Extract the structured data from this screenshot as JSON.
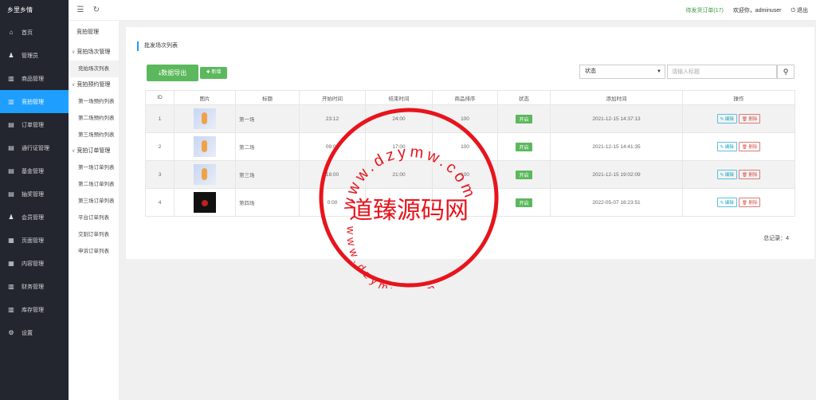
{
  "app": {
    "brand": "乡里乡情"
  },
  "sidebar": {
    "items": [
      {
        "label": "首页",
        "icon": "home-icon",
        "glyph": "⌂"
      },
      {
        "label": "管理员",
        "icon": "user-icon",
        "glyph": "♟"
      },
      {
        "label": "商品管理",
        "icon": "gift-icon",
        "glyph": "▥"
      },
      {
        "label": "竞拍管理",
        "icon": "gift-icon",
        "glyph": "▥",
        "active": true
      },
      {
        "label": "订单管理",
        "icon": "list-icon",
        "glyph": "▤"
      },
      {
        "label": "通行证管理",
        "icon": "list-icon",
        "glyph": "▤"
      },
      {
        "label": "基金管理",
        "icon": "list-icon",
        "glyph": "▤"
      },
      {
        "label": "抽奖管理",
        "icon": "list-icon",
        "glyph": "▤"
      },
      {
        "label": "会员管理",
        "icon": "member-icon",
        "glyph": "♟"
      },
      {
        "label": "页面管理",
        "icon": "page-icon",
        "glyph": "▦"
      },
      {
        "label": "内容管理",
        "icon": "page-icon",
        "glyph": "▦"
      },
      {
        "label": "财务管理",
        "icon": "chart-icon",
        "glyph": "▥"
      },
      {
        "label": "库存管理",
        "icon": "chart-icon",
        "glyph": "▥"
      },
      {
        "label": "设置",
        "icon": "gear-icon",
        "glyph": "⚙"
      }
    ]
  },
  "topbar": {
    "pending_orders": "待发货订单(17)",
    "welcome": "欢迎你，adminuser",
    "logout": "退出"
  },
  "subnav": {
    "title": "竞拍管理",
    "groups": [
      {
        "label": "竞拍场次管理",
        "links": [
          "竞拍场次列表"
        ]
      },
      {
        "label": "竞拍预约管理",
        "links": [
          "第一场预约列表",
          "第二场预约列表",
          "第三场预约列表"
        ]
      },
      {
        "label": "竞拍订单管理",
        "links": [
          "第一场订单列表",
          "第二场订单列表",
          "第三场订单列表",
          "平台订单列表",
          "交割订单列表",
          "申诉订单列表"
        ]
      }
    ]
  },
  "panel": {
    "title": "批发场次列表",
    "export_label": "数据导出",
    "new_label": "新增",
    "status_select": "状态",
    "search_placeholder": "请输入标题",
    "total": "总记录：4"
  },
  "table": {
    "headers": [
      "ID",
      "图片",
      "标题",
      "开始时间",
      "结束时间",
      "商品排序",
      "状态",
      "添加时间",
      "操作"
    ],
    "rows": [
      {
        "id": "1",
        "title": "第一场",
        "start": "23:12",
        "end": "24:00",
        "sort": "100",
        "status": "开启",
        "added": "2021-12-15 14:37:13",
        "img": "light"
      },
      {
        "id": "2",
        "title": "第二场",
        "start": "09:00",
        "end": "17:00",
        "sort": "100",
        "status": "开启",
        "added": "2021-12-15 14:41:35",
        "img": "light"
      },
      {
        "id": "3",
        "title": "第三场",
        "start": "18:00",
        "end": "21:00",
        "sort": "100",
        "status": "开启",
        "added": "2021-12-15 19:02:09",
        "img": "light"
      },
      {
        "id": "4",
        "title": "第四场",
        "start": "0:00",
        "end": "",
        "sort": "",
        "status": "开启",
        "added": "2022-05-07 16:23:51",
        "img": "dark"
      }
    ],
    "edit_label": "编辑",
    "delete_label": "删除"
  },
  "watermark": {
    "center_text": "道臻源码网",
    "top_text": "www.dzymw.com",
    "bottom_text": "www.dzymw.com",
    "color": "#e8141c"
  }
}
